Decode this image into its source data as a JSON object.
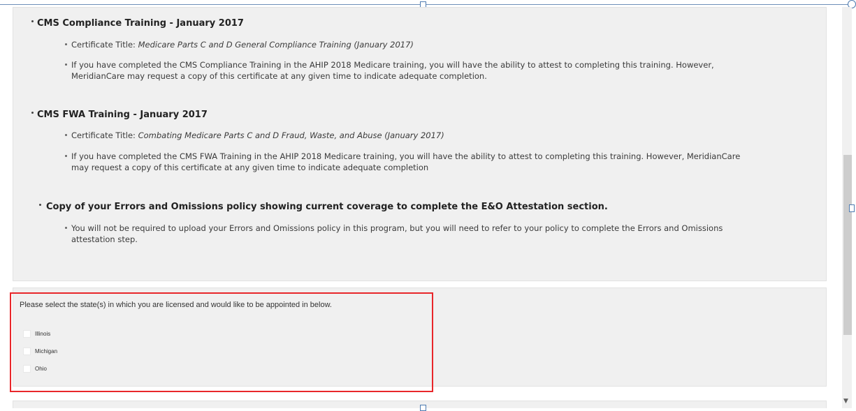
{
  "sections": [
    {
      "title": "CMS Compliance Training - January 2017",
      "items": [
        {
          "prefix": "Certificate Title: ",
          "emphasis": "Medicare Parts C and D General Compliance Training (January 2017)"
        },
        {
          "line1": "If you have completed the CMS Compliance Training in the AHIP 2018 Medicare training, you will have the ability to attest to completing this training. However,",
          "line2": "MeridianCare may request a copy of this certificate at any given time to indicate adequate completion."
        }
      ]
    },
    {
      "title": "CMS FWA Training - January 2017",
      "items": [
        {
          "prefix": "Certificate Title: ",
          "emphasis": "Combating Medicare Parts C and D Fraud, Waste, and Abuse (January 2017)"
        },
        {
          "line1": "If you have completed the CMS FWA Training in the AHIP 2018 Medicare training, you will have the ability to attest to completing this training. However, MeridianCare",
          "line2": "may request a copy of this certificate at any given time to indicate adequate completion"
        }
      ]
    },
    {
      "title": "Copy of your Errors and Omissions policy showing current coverage to complete the E&O Attestation section.",
      "items": [
        {
          "line1": "You will not be required to upload your Errors and Omissions policy in this program, but you will need to refer to your policy to complete the Errors and Omissions",
          "line2": "attestation step."
        }
      ]
    }
  ],
  "states_form": {
    "prompt": "Please select the state(s) in which you are licensed and would like to be appointed in below.",
    "options": [
      {
        "label": "Illinois",
        "checked": false
      },
      {
        "label": "Michigan",
        "checked": false
      },
      {
        "label": "Ohio",
        "checked": false
      }
    ]
  },
  "colors": {
    "highlight": "#e8262a",
    "panel": "#f0f0f0"
  }
}
